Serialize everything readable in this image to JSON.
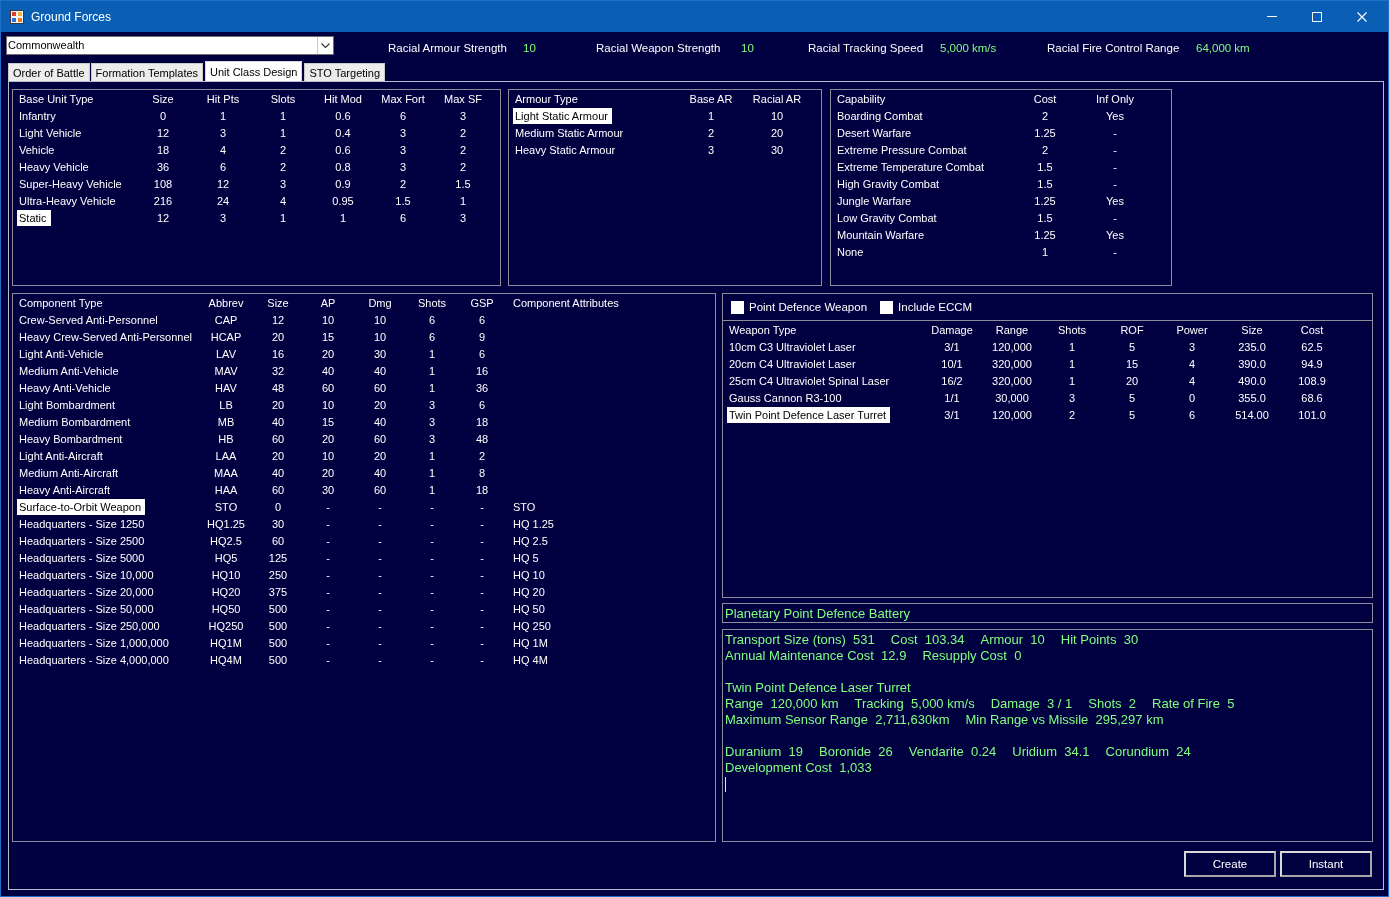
{
  "window": {
    "title": "Ground Forces"
  },
  "race_selector": {
    "value": "Commonwealth"
  },
  "racial_stats": [
    {
      "label": "Racial Armour Strength",
      "value": "10"
    },
    {
      "label": "Racial Weapon Strength",
      "value": "10"
    },
    {
      "label": "Racial Tracking Speed",
      "value": "5,000 km/s"
    },
    {
      "label": "Racial Fire Control Range",
      "value": "64,000 km"
    }
  ],
  "tabs": [
    {
      "label": "Order of Battle",
      "selected": false
    },
    {
      "label": "Formation Templates",
      "selected": false
    },
    {
      "label": "Unit Class Design",
      "selected": true
    },
    {
      "label": "STO Targeting",
      "selected": false
    }
  ],
  "base_unit_table": {
    "columns": [
      "Base Unit Type",
      "Size",
      "Hit Pts",
      "Slots",
      "Hit Mod",
      "Max Fort",
      "Max SF"
    ],
    "rows": [
      {
        "cells": [
          "Infantry",
          "0",
          "1",
          "1",
          "0.6",
          "6",
          "3"
        ],
        "selected": false
      },
      {
        "cells": [
          "Light Vehicle",
          "12",
          "3",
          "1",
          "0.4",
          "3",
          "2"
        ],
        "selected": false
      },
      {
        "cells": [
          "Vehicle",
          "18",
          "4",
          "2",
          "0.6",
          "3",
          "2"
        ],
        "selected": false
      },
      {
        "cells": [
          "Heavy Vehicle",
          "36",
          "6",
          "2",
          "0.8",
          "3",
          "2"
        ],
        "selected": false
      },
      {
        "cells": [
          "Super-Heavy Vehicle",
          "108",
          "12",
          "3",
          "0.9",
          "2",
          "1.5"
        ],
        "selected": false
      },
      {
        "cells": [
          "Ultra-Heavy Vehicle",
          "216",
          "24",
          "4",
          "0.95",
          "1.5",
          "1"
        ],
        "selected": false
      },
      {
        "cells": [
          "Static",
          "12",
          "3",
          "1",
          "1",
          "6",
          "3"
        ],
        "selected": true
      }
    ]
  },
  "armour_table": {
    "columns": [
      "Armour Type",
      "Base AR",
      "Racial AR"
    ],
    "rows": [
      {
        "cells": [
          "Light Static Armour",
          "1",
          "10"
        ],
        "selected": true
      },
      {
        "cells": [
          "Medium Static Armour",
          "2",
          "20"
        ],
        "selected": false
      },
      {
        "cells": [
          "Heavy Static Armour",
          "3",
          "30"
        ],
        "selected": false
      }
    ]
  },
  "capability_table": {
    "columns": [
      "Capability",
      "Cost",
      "Inf Only"
    ],
    "rows": [
      {
        "cells": [
          "Boarding Combat",
          "2",
          "Yes"
        ],
        "selected": false
      },
      {
        "cells": [
          "Desert Warfare",
          "1.25",
          "-"
        ],
        "selected": false
      },
      {
        "cells": [
          "Extreme Pressure Combat",
          "2",
          "-"
        ],
        "selected": false
      },
      {
        "cells": [
          "Extreme Temperature Combat",
          "1.5",
          "-"
        ],
        "selected": false
      },
      {
        "cells": [
          "High Gravity Combat",
          "1.5",
          "-"
        ],
        "selected": false
      },
      {
        "cells": [
          "Jungle Warfare",
          "1.25",
          "Yes"
        ],
        "selected": false
      },
      {
        "cells": [
          "Low Gravity Combat",
          "1.5",
          "-"
        ],
        "selected": false
      },
      {
        "cells": [
          "Mountain Warfare",
          "1.25",
          "Yes"
        ],
        "selected": false
      },
      {
        "cells": [
          "None",
          "1",
          "-"
        ],
        "selected": false
      }
    ]
  },
  "component_table": {
    "columns": [
      "Component Type",
      "Abbrev",
      "Size",
      "AP",
      "Dmg",
      "Shots",
      "GSP",
      "Component Attributes"
    ],
    "rows": [
      {
        "cells": [
          "Crew-Served Anti-Personnel",
          "CAP",
          "12",
          "10",
          "10",
          "6",
          "6"
        ],
        "selected": false
      },
      {
        "cells": [
          "Heavy Crew-Served Anti-Personnel",
          "HCAP",
          "20",
          "15",
          "10",
          "6",
          "9"
        ],
        "selected": false
      },
      {
        "cells": [
          "Light Anti-Vehicle",
          "LAV",
          "16",
          "20",
          "30",
          "1",
          "6"
        ],
        "selected": false
      },
      {
        "cells": [
          "Medium Anti-Vehicle",
          "MAV",
          "32",
          "40",
          "40",
          "1",
          "16"
        ],
        "selected": false
      },
      {
        "cells": [
          "Heavy Anti-Vehicle",
          "HAV",
          "48",
          "60",
          "60",
          "1",
          "36"
        ],
        "selected": false
      },
      {
        "cells": [
          "Light Bombardment",
          "LB",
          "20",
          "10",
          "20",
          "3",
          "6"
        ],
        "selected": false
      },
      {
        "cells": [
          "Medium Bombardment",
          "MB",
          "40",
          "15",
          "40",
          "3",
          "18"
        ],
        "selected": false
      },
      {
        "cells": [
          "Heavy Bombardment",
          "HB",
          "60",
          "20",
          "60",
          "3",
          "48"
        ],
        "selected": false
      },
      {
        "cells": [
          "Light Anti-Aircraft",
          "LAA",
          "20",
          "10",
          "20",
          "1",
          "2"
        ],
        "selected": false
      },
      {
        "cells": [
          "Medium Anti-Aircraft",
          "MAA",
          "40",
          "20",
          "40",
          "1",
          "8"
        ],
        "selected": false
      },
      {
        "cells": [
          "Heavy Anti-Aircraft",
          "HAA",
          "60",
          "30",
          "60",
          "1",
          "18"
        ],
        "selected": false
      },
      {
        "cells": [
          "Surface-to-Orbit Weapon",
          "STO",
          "0",
          "-",
          "-",
          "-",
          "-",
          "STO"
        ],
        "selected": true
      },
      {
        "cells": [
          "Headquarters - Size 1250",
          "HQ1.25",
          "30",
          "-",
          "-",
          "-",
          "-",
          "HQ 1.25"
        ],
        "selected": false
      },
      {
        "cells": [
          "Headquarters - Size 2500",
          "HQ2.5",
          "60",
          "-",
          "-",
          "-",
          "-",
          "HQ 2.5"
        ],
        "selected": false
      },
      {
        "cells": [
          "Headquarters - Size 5000",
          "HQ5",
          "125",
          "-",
          "-",
          "-",
          "-",
          "HQ 5"
        ],
        "selected": false
      },
      {
        "cells": [
          "Headquarters - Size 10,000",
          "HQ10",
          "250",
          "-",
          "-",
          "-",
          "-",
          "HQ 10"
        ],
        "selected": false
      },
      {
        "cells": [
          "Headquarters - Size 20,000",
          "HQ20",
          "375",
          "-",
          "-",
          "-",
          "-",
          "HQ 20"
        ],
        "selected": false
      },
      {
        "cells": [
          "Headquarters - Size 50,000",
          "HQ50",
          "500",
          "-",
          "-",
          "-",
          "-",
          "HQ 50"
        ],
        "selected": false
      },
      {
        "cells": [
          "Headquarters - Size 250,000",
          "HQ250",
          "500",
          "-",
          "-",
          "-",
          "-",
          "HQ 250"
        ],
        "selected": false
      },
      {
        "cells": [
          "Headquarters - Size 1,000,000",
          "HQ1M",
          "500",
          "-",
          "-",
          "-",
          "-",
          "HQ 1M"
        ],
        "selected": false
      },
      {
        "cells": [
          "Headquarters - Size 4,000,000",
          "HQ4M",
          "500",
          "-",
          "-",
          "-",
          "-",
          "HQ 4M"
        ],
        "selected": false
      }
    ]
  },
  "weapon_options": [
    {
      "label": "Point Defence Weapon",
      "checked": false
    },
    {
      "label": "Include ECCM",
      "checked": false
    }
  ],
  "weapon_table": {
    "columns": [
      "Weapon Type",
      "Damage",
      "Range",
      "Shots",
      "ROF",
      "Power",
      "Size",
      "Cost"
    ],
    "rows": [
      {
        "cells": [
          "10cm C3 Ultraviolet Laser",
          "3/1",
          "120,000",
          "1",
          "5",
          "3",
          "235.0",
          "62.5"
        ],
        "selected": false
      },
      {
        "cells": [
          "20cm C4 Ultraviolet Laser",
          "10/1",
          "320,000",
          "1",
          "15",
          "4",
          "390.0",
          "94.9"
        ],
        "selected": false
      },
      {
        "cells": [
          "25cm C4 Ultraviolet Spinal Laser",
          "16/2",
          "320,000",
          "1",
          "20",
          "4",
          "490.0",
          "108.9"
        ],
        "selected": false
      },
      {
        "cells": [
          "Gauss Cannon R3-100",
          "1/1",
          "30,000",
          "3",
          "5",
          "0",
          "355.0",
          "68.6"
        ],
        "selected": false
      },
      {
        "cells": [
          "Twin Point Defence Laser Turret",
          "3/1",
          "120,000",
          "2",
          "5",
          "6",
          "514.00",
          "101.0"
        ],
        "selected": true
      }
    ]
  },
  "unit_name": {
    "value": "Planetary Point Defence Battery"
  },
  "summary": {
    "blocks": [
      [
        [
          "Transport Size (tons)  531",
          "Cost  103.34",
          "Armour  10",
          "Hit Points  30"
        ],
        [
          "Annual Maintenance Cost  12.9",
          "Resupply Cost  0"
        ]
      ],
      [
        [
          "Twin Point Defence Laser Turret"
        ],
        [
          "Range  120,000 km",
          "Tracking  5,000 km/s",
          "Damage  3 / 1",
          "Shots  2",
          "Rate of Fire  5"
        ],
        [
          "Maximum Sensor Range  2,711,630km",
          "Min Range vs Missile  295,297 km"
        ]
      ],
      [
        [
          "Duranium  19",
          "Boronide  26",
          "Vendarite  0.24",
          "Uridium  34.1",
          "Corundium  24"
        ],
        [
          "Development Cost  1,033"
        ]
      ]
    ],
    "focused": true
  },
  "buttons": [
    {
      "label": "Create"
    },
    {
      "label": "Instant"
    }
  ]
}
